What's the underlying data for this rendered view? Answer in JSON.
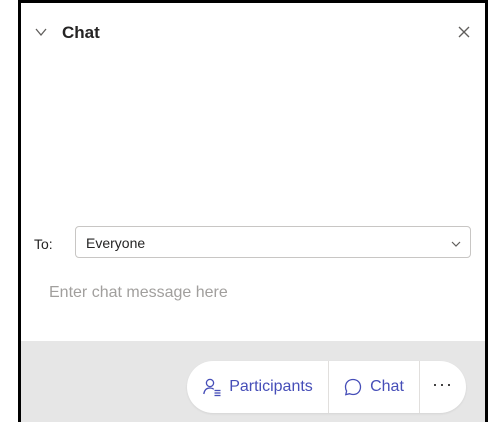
{
  "panel": {
    "title": "Chat",
    "close_label": "×"
  },
  "recipient": {
    "label": "To:",
    "selected": "Everyone"
  },
  "composer": {
    "placeholder": "Enter chat message here"
  },
  "footer": {
    "participants_label": "Participants",
    "chat_label": "Chat",
    "more_label": "···"
  },
  "colors": {
    "accent": "#464eb8",
    "footer_bg": "#e6e6e6",
    "text": "#252424",
    "placeholder": "#a19f9d"
  }
}
